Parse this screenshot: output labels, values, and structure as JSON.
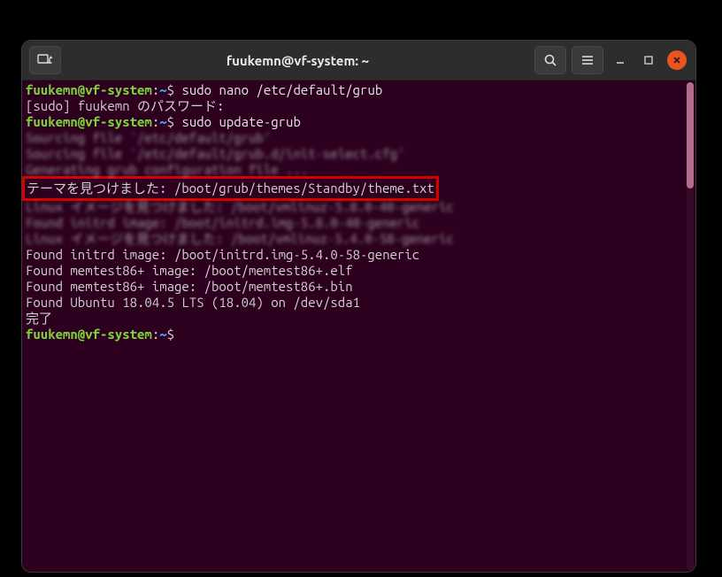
{
  "window": {
    "title": "fuukemn@vf-system: ~"
  },
  "prompt": {
    "user_host": "fuukemn@vf-system",
    "colon": ":",
    "path": "~",
    "sigil": "$"
  },
  "lines": {
    "cmd1": "sudo nano /etc/default/grub",
    "sudo_pw": "[sudo] fuukemn のパスワード:",
    "cmd2": "sudo update-grub",
    "src1": "Sourcing file `/etc/default/grub'",
    "src2": "Sourcing file `/etc/default/grub.d/init-select.cfg'",
    "gen": "Generating grub configuration file ...",
    "theme": "テーマを見つけました: /boot/grub/themes/Standby/theme.txt",
    "linimg1": "Linux イメージを見つけました: /boot/vmlinuz-5.8.0-40-generic",
    "initrd1": "Found initrd image: /boot/initrd.img-5.8.0-40-generic",
    "linimg2": "Linux イメージを見つけました: /boot/vmlinuz-5.4.0-58-generic",
    "initrd2": "Found initrd image: /boot/initrd.img-5.4.0-58-generic",
    "mem1": "Found memtest86+ image: /boot/memtest86+.elf",
    "mem2": "Found memtest86+ image: /boot/memtest86+.bin",
    "ubuntu": "Found Ubuntu 18.04.5 LTS (18.04) on /dev/sda1",
    "done": "完了"
  }
}
